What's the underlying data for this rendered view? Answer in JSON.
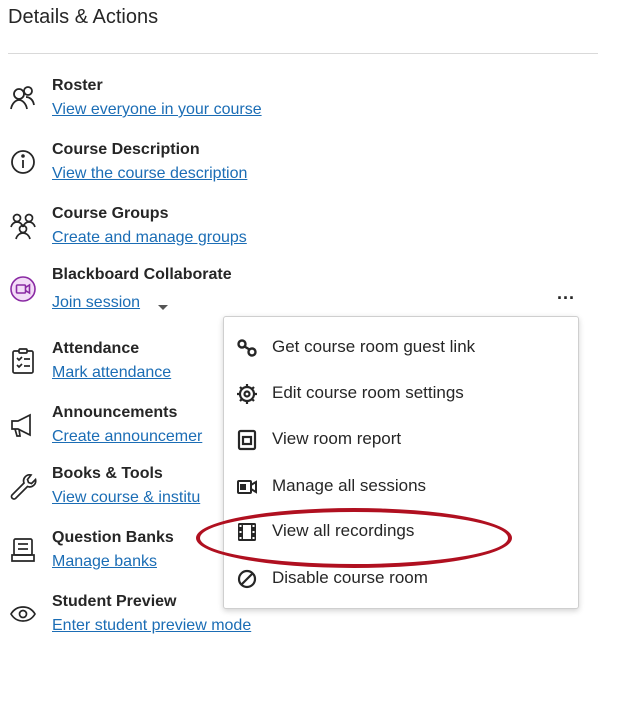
{
  "header": {
    "title": "Details & Actions"
  },
  "items": [
    {
      "title": "Roster",
      "link": "View everyone in your course",
      "icon": "roster-icon"
    },
    {
      "title": "Course Description",
      "link": "View the course description",
      "icon": "info-icon"
    },
    {
      "title": "Course Groups",
      "link": "Create and manage groups",
      "icon": "groups-icon"
    },
    {
      "title": "Blackboard Collaborate",
      "link": "Join session",
      "icon": "collaborate-icon"
    },
    {
      "title": "Attendance",
      "link": "Mark attendance",
      "icon": "attendance-icon"
    },
    {
      "title": "Announcements",
      "link": "Create announcemer",
      "icon": "megaphone-icon"
    },
    {
      "title": "Books & Tools",
      "link": "View course & institu",
      "icon": "wrench-icon"
    },
    {
      "title": "Question Banks",
      "link": "Manage banks",
      "icon": "question-bank-icon"
    },
    {
      "title": "Student Preview",
      "link": "Enter student preview mode",
      "icon": "eye-icon"
    }
  ],
  "more_button": {
    "label": "..."
  },
  "menu": {
    "items": [
      {
        "label": "Get course room guest link",
        "icon": "link-icon"
      },
      {
        "label": "Edit course room settings",
        "icon": "gear-icon"
      },
      {
        "label": "View room report",
        "icon": "report-icon"
      },
      {
        "label": "Manage all sessions",
        "icon": "sessions-icon"
      },
      {
        "label": "View all recordings",
        "icon": "film-icon"
      },
      {
        "label": "Disable course room",
        "icon": "disable-icon"
      }
    ]
  },
  "colors": {
    "link": "#1b6db5",
    "highlight": "#b01020",
    "collaborate": "#8a2aa3"
  }
}
